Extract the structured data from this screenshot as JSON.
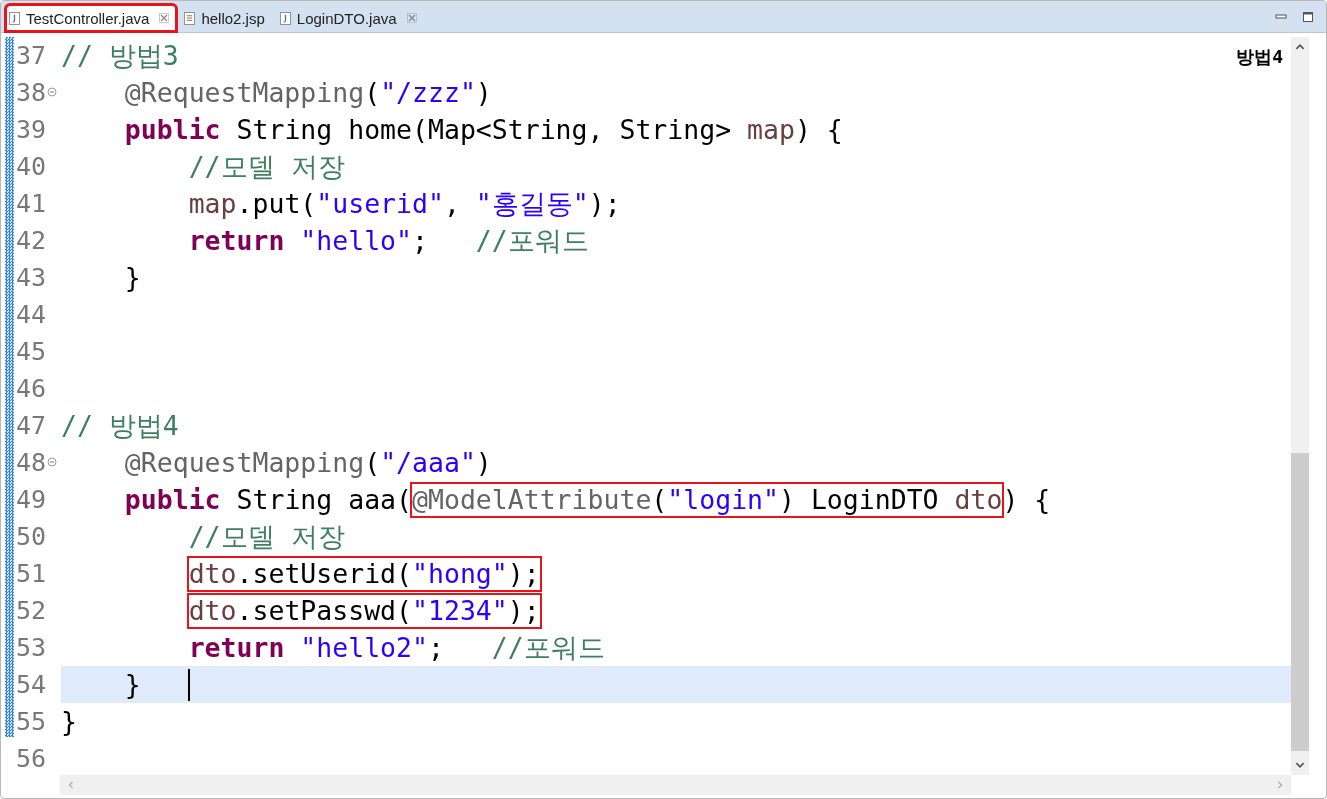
{
  "tabs": [
    {
      "label": "TestController.java",
      "kind": "java",
      "selected": true,
      "closable": true,
      "highlighted": true
    },
    {
      "label": "hello2.jsp",
      "kind": "jsp",
      "selected": false,
      "closable": false,
      "highlighted": false
    },
    {
      "label": "LoginDTO.java",
      "kind": "java",
      "selected": false,
      "closable": true,
      "highlighted": false
    }
  ],
  "editor": {
    "overlay_label": "방법4",
    "lines": [
      {
        "number": "37",
        "foldable": false,
        "current": false,
        "tokens": [
          {
            "kind": "comment",
            "text": "// 방법3"
          }
        ]
      },
      {
        "number": "38",
        "foldable": true,
        "current": false,
        "tokens": [
          {
            "kind": "annotation",
            "text": "    @RequestMapping"
          },
          {
            "kind": "plain",
            "text": "("
          },
          {
            "kind": "string",
            "text": "\"/zzz\""
          },
          {
            "kind": "plain",
            "text": ")"
          }
        ]
      },
      {
        "number": "39",
        "foldable": false,
        "current": false,
        "tokens": [
          {
            "kind": "keyword",
            "text": "    public"
          },
          {
            "kind": "plain",
            "text": " String home(Map<String, String> "
          },
          {
            "kind": "variable",
            "text": "map"
          },
          {
            "kind": "plain",
            "text": ") {"
          }
        ]
      },
      {
        "number": "40",
        "foldable": false,
        "current": false,
        "tokens": [
          {
            "kind": "comment",
            "text": "        //모델 저장"
          }
        ]
      },
      {
        "number": "41",
        "foldable": false,
        "current": false,
        "tokens": [
          {
            "kind": "variable",
            "text": "        map"
          },
          {
            "kind": "plain",
            "text": ".put("
          },
          {
            "kind": "string",
            "text": "\"userid\""
          },
          {
            "kind": "plain",
            "text": ", "
          },
          {
            "kind": "string",
            "text": "\"홍길동\""
          },
          {
            "kind": "plain",
            "text": ");"
          }
        ]
      },
      {
        "number": "42",
        "foldable": false,
        "current": false,
        "tokens": [
          {
            "kind": "keyword",
            "text": "        return"
          },
          {
            "kind": "string",
            "text": " \"hello\""
          },
          {
            "kind": "plain",
            "text": ";   "
          },
          {
            "kind": "comment",
            "text": "//포워드"
          }
        ]
      },
      {
        "number": "43",
        "foldable": false,
        "current": false,
        "tokens": [
          {
            "kind": "plain",
            "text": "    }"
          }
        ]
      },
      {
        "number": "44",
        "foldable": false,
        "current": false
      },
      {
        "number": "45",
        "foldable": false,
        "current": false
      },
      {
        "number": "46",
        "foldable": false,
        "current": false
      },
      {
        "number": "47",
        "foldable": false,
        "current": false,
        "tokens": [
          {
            "kind": "comment",
            "text": "// 방법4"
          }
        ]
      },
      {
        "number": "48",
        "foldable": true,
        "current": false,
        "tokens": [
          {
            "kind": "annotation",
            "text": "    @RequestMapping"
          },
          {
            "kind": "plain",
            "text": "("
          },
          {
            "kind": "string",
            "text": "\"/aaa\""
          },
          {
            "kind": "plain",
            "text": ")"
          }
        ]
      },
      {
        "number": "49",
        "foldable": false,
        "current": false,
        "tokens": [
          {
            "kind": "keyword",
            "text": "    public"
          },
          {
            "kind": "plain",
            "text": " String aaa("
          },
          {
            "kind": "box",
            "tokens": [
              {
                "kind": "annotation",
                "text": "@ModelAttribute"
              },
              {
                "kind": "plain",
                "text": "("
              },
              {
                "kind": "string",
                "text": "\"login\""
              },
              {
                "kind": "plain",
                "text": ") LoginDTO "
              },
              {
                "kind": "variable",
                "text": "dto"
              }
            ]
          },
          {
            "kind": "plain",
            "text": ") {"
          }
        ]
      },
      {
        "number": "50",
        "foldable": false,
        "current": false,
        "tokens": [
          {
            "kind": "comment",
            "text": "        //모델 저장"
          }
        ]
      },
      {
        "number": "51",
        "foldable": false,
        "current": false,
        "tokens": [
          {
            "kind": "box",
            "tokens": [
              {
                "kind": "variable",
                "text": "        dto"
              },
              {
                "kind": "plain",
                "text": ".setUserid("
              },
              {
                "kind": "string",
                "text": "\"hong\""
              },
              {
                "kind": "plain",
                "text": ");"
              }
            ]
          }
        ]
      },
      {
        "number": "52",
        "foldable": false,
        "current": false,
        "tokens": [
          {
            "kind": "box",
            "tokens": [
              {
                "kind": "variable",
                "text": "        dto"
              },
              {
                "kind": "plain",
                "text": ".setPasswd("
              },
              {
                "kind": "string",
                "text": "\"1234\""
              },
              {
                "kind": "plain",
                "text": ");"
              }
            ]
          }
        ]
      },
      {
        "number": "53",
        "foldable": false,
        "current": false,
        "tokens": [
          {
            "kind": "keyword",
            "text": "        return"
          },
          {
            "kind": "string",
            "text": " \"hello2\""
          },
          {
            "kind": "plain",
            "text": ";   "
          },
          {
            "kind": "comment",
            "text": "//포워드"
          }
        ]
      },
      {
        "number": "54",
        "foldable": false,
        "current": true,
        "tokens": [
          {
            "kind": "plain",
            "text": "    }"
          }
        ]
      },
      {
        "number": "55",
        "foldable": false,
        "current": false,
        "tokens": [
          {
            "kind": "plain",
            "text": "}"
          }
        ]
      },
      {
        "number": "56",
        "foldable": false,
        "current": false
      }
    ]
  }
}
